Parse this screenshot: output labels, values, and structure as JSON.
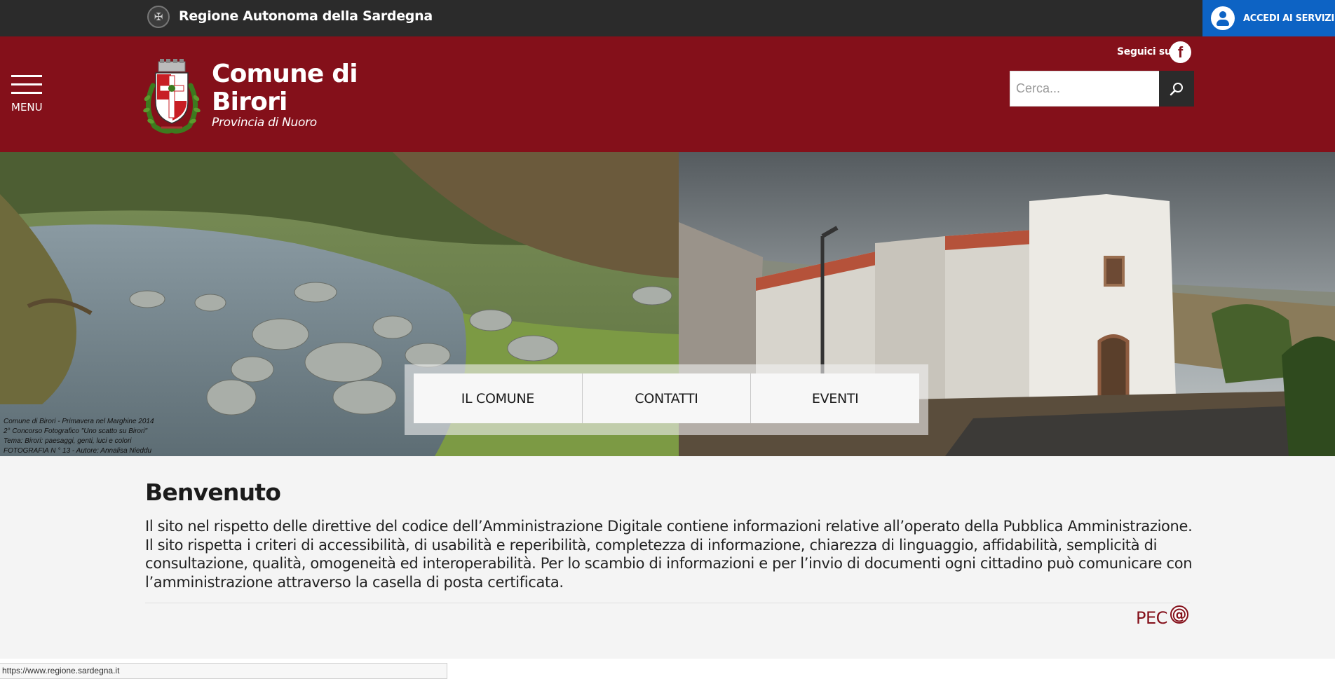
{
  "topbar": {
    "region_name": "Regione Autonoma della Sardegna",
    "access_label": "ACCEDI AI SERVIZI"
  },
  "header": {
    "menu_label": "MENU",
    "title": "Comune di Birori",
    "subtitle": "Provincia di Nuoro",
    "follow_label": "Seguici su:",
    "facebook_glyph": "f",
    "search_placeholder": "Cerca..."
  },
  "hero": {
    "caption": [
      "Comune di Birori - Primavera nel Marghine 2014",
      "2° Concorso Fotografico \"Uno scatto su Birori\"",
      "Tema: Birori: paesaggi, genti, luci e colori",
      "FOTOGRAFIA N ° 13 - Autore: Annalisa Nieddu"
    ],
    "quick_links": [
      "IL COMUNE",
      "CONTATTI",
      "EVENTI"
    ]
  },
  "content": {
    "welcome_title": "Benvenuto",
    "welcome_text": "Il sito nel rispetto delle direttive del codice dell’Amministrazione Digitale contiene informazioni relative all’operato della Pubblica Amministrazione. Il sito rispetta i criteri di accessibilità, di usabilità e reperibilità, completezza di informazione, chiarezza di linguaggio, affidabilità, semplicità di consultazione, qualità, omogeneità ed interoperabilità. Per lo scambio di informazioni e per l’invio di documenti ogni cittadino può comunicare con l’amministrazione attraverso la casella di posta certificata.",
    "pec_label": "PEC",
    "pec_glyph": "@"
  },
  "status": {
    "url": "https://www.regione.sardegna.it"
  },
  "colors": {
    "topbar": "#2b2b2b",
    "brand_red": "#84101a",
    "access_blue": "#0d63c4",
    "page_bg": "#f4f4f4"
  },
  "icons": [
    "region-emblem-icon",
    "user-icon",
    "hamburger-icon",
    "crest-logo",
    "facebook-icon",
    "search-icon",
    "pec-at-icon"
  ]
}
